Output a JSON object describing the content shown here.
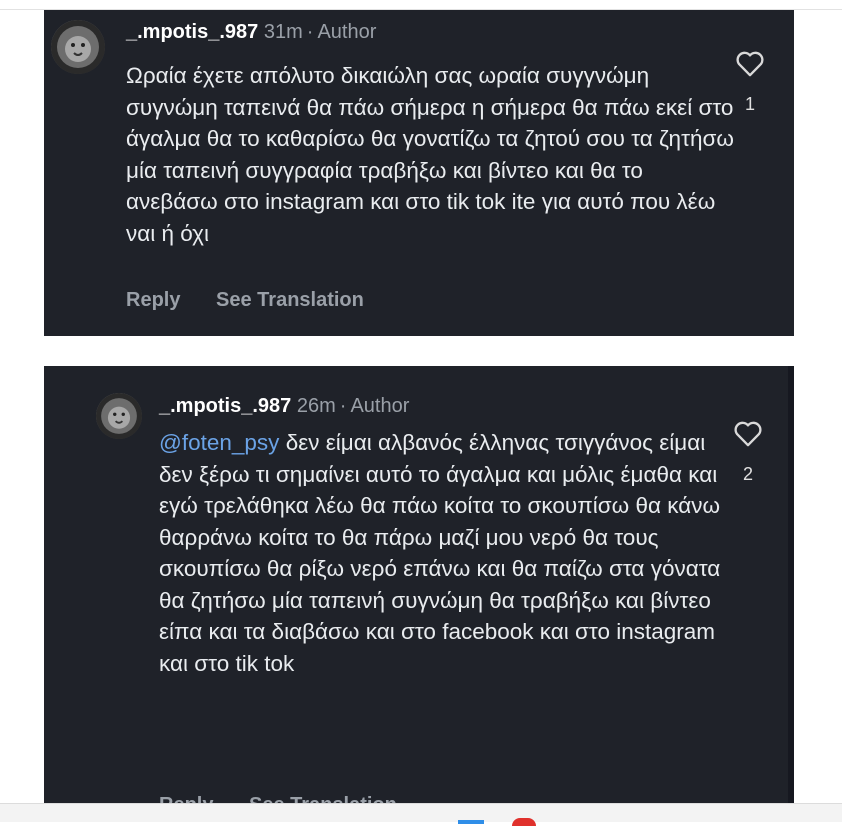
{
  "comments": [
    {
      "username": "_.mpotis_.987",
      "time": "31m",
      "role": "Author",
      "mention": "",
      "text": "Ωραία έχετε απόλυτο δικαιώλη σας ωραία συγγνώμη συγνώμη ταπεινά θα πάω σήμερα η σήμερα θα πάω εκεί στο άγαλμα θα το καθαρίσω θα γονατίζω τα ζητού σου τα ζητήσω μία ταπεινή συγγραφία τραβήξω και βίντεο και θα το ανεβάσω στο instagram και στο tik tok ite για αυτό που λέω ναι ή όχι",
      "reply_label": "Reply",
      "translation_label": "See Translation",
      "likes": "1",
      "like_icon": "heart-outline-icon"
    },
    {
      "username": "_.mpotis_.987",
      "time": "26m",
      "role": "Author",
      "mention": "@foten_psy",
      "text": "δεν είμαι αλβανός έλληνας τσιγγάνος είμαι δεν ξέρω τι σημαίνει αυτό το άγαλμα και μόλις έμαθα και εγώ τρελάθηκα λέω θα πάω κοίτα το σκουπίσω θα κάνω θαρράνω κοίτα το θα πάρω μαζί μου νερό θα τους σκουπίσω θα ρίξω νερό επάνω και θα παίζω στα γόνατα θα ζητήσω μία ταπεινή συγνώμη θα τραβήξω και βίντεο είπα και τα διαβάσω και στο facebook και στο instagram και στο tik tok",
      "reply_label": "Reply",
      "translation_label": "See Translation",
      "likes": "2",
      "like_icon": "heart-outline-icon"
    }
  ],
  "separator": "·",
  "colors": {
    "card_background": "#1f2229",
    "mention": "#6ba3e6",
    "meta_text": "#9aa0a8",
    "body_text": "#e9ecef"
  }
}
